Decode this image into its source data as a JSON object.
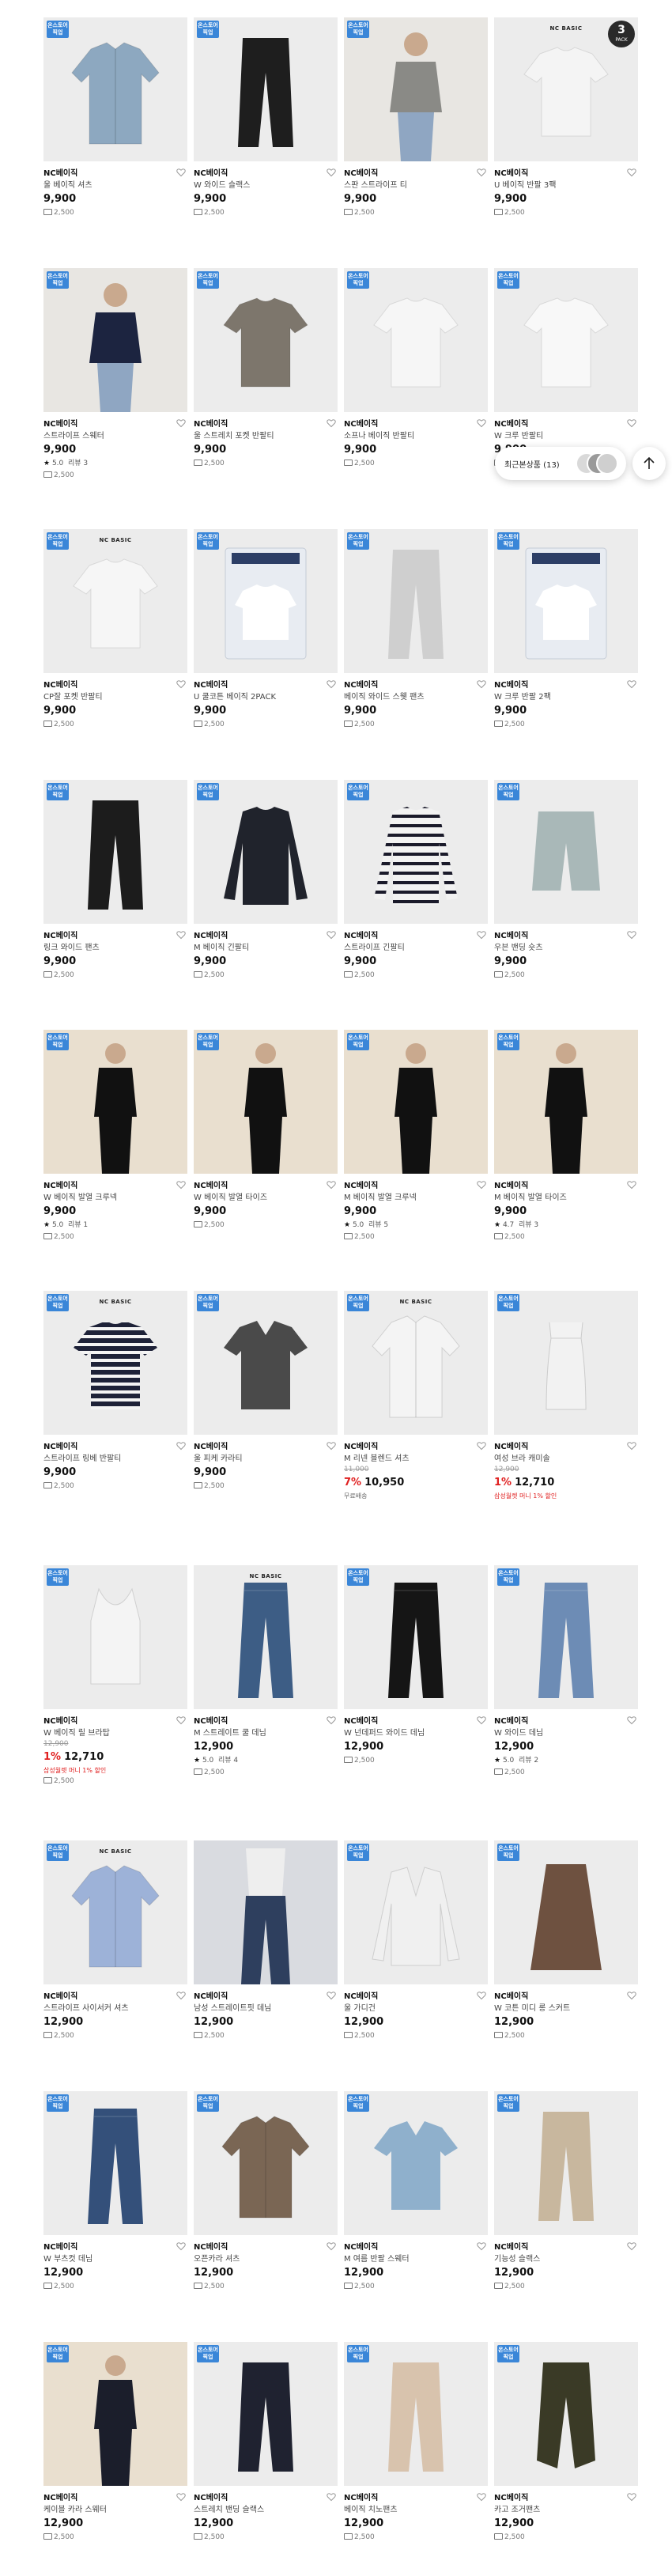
{
  "colors": {
    "badge": "#3a86d8",
    "discount": "#e02020",
    "accent": "#111111"
  },
  "recent": {
    "label": "최근본상품 (13)"
  },
  "products": [
    {
      "badge": "온스토어 픽업",
      "brand": "NC베이직",
      "name": "울 베이직 셔츠",
      "price": "9,900",
      "ship": "2,500",
      "img": "shirt",
      "color": "#8da8c0"
    },
    {
      "badge": "온스토어 픽업",
      "brand": "NC베이직",
      "name": "W 와이드 슬랙스",
      "price": "9,900",
      "ship": "2,500",
      "img": "pants",
      "color": "#1e1e1e"
    },
    {
      "badge": "온스토어 픽업",
      "brand": "NC베이직",
      "name": "스판 스트라이프 티",
      "price": "9,900",
      "ship": "2,500",
      "img": "model-stripe",
      "color": "#8a8a86"
    },
    {
      "brand_mark": "NC BASIC",
      "pack": {
        "n": "3",
        "t": "PACK"
      },
      "brand": "NC베이직",
      "name": "U 베이직 반팔 3팩",
      "price": "9,900",
      "ship": "2,500",
      "img": "tee",
      "color": "#f4f4f4"
    },
    {
      "badge": "온스토어 픽업",
      "brand": "NC베이직",
      "name": "스트라이프 스웨터",
      "price": "9,900",
      "rating": "5.0",
      "reviews": "리뷰 3",
      "ship": "2,500",
      "img": "model-stripe",
      "color": "#1c2440"
    },
    {
      "badge": "온스토어 픽업",
      "brand": "NC베이직",
      "name": "울 스트레치 포켓 반팔티",
      "price": "9,900",
      "ship": "2,500",
      "img": "tee",
      "color": "#7d766c"
    },
    {
      "badge": "온스토어 픽업",
      "brand": "NC베이직",
      "name": "소프나 베이직 반팔티",
      "price": "9,900",
      "ship": "2,500",
      "img": "tee",
      "color": "#f6f6f6"
    },
    {
      "badge": "온스토어 픽업",
      "brand": "NC베이직",
      "name": "W 크루 반팔티",
      "price": "9,900",
      "ship": "2,500",
      "img": "tee",
      "color": "#f8f8f8"
    },
    {
      "badge": "온스토어 픽업",
      "brand_mark": "NC BASIC",
      "brand": "NC베이직",
      "name": "CP잘 포켓 반팔티",
      "price": "9,900",
      "ship": "2,500",
      "img": "tee",
      "color": "#f6f6f6"
    },
    {
      "badge": "온스토어 픽업",
      "brand": "NC베이직",
      "name": "U 쿨코튼 베이직 2PACK",
      "price": "9,900",
      "ship": "2,500",
      "img": "package",
      "color": "#e8ecf2"
    },
    {
      "badge": "온스토어 픽업",
      "brand": "NC베이직",
      "name": "베이직 와이드 스웻 팬츠",
      "price": "9,900",
      "ship": "2,500",
      "img": "pants",
      "color": "#cfcfcf"
    },
    {
      "badge": "온스토어 픽업",
      "brand": "NC베이직",
      "name": "W 크루 반팔 2팩",
      "price": "9,900",
      "ship": "2,500",
      "img": "package",
      "color": "#e8ecf2"
    },
    {
      "badge": "온스토어 픽업",
      "brand": "NC베이직",
      "name": "링크 와이드 팬츠",
      "price": "9,900",
      "ship": "2,500",
      "img": "pants",
      "color": "#1c1c1c"
    },
    {
      "badge": "온스토어 픽업",
      "brand": "NC베이직",
      "name": "M 베이직 긴팔티",
      "price": "9,900",
      "ship": "2,500",
      "img": "longsleeve",
      "color": "#20232c"
    },
    {
      "badge": "온스토어 픽업",
      "brand": "NC베이직",
      "name": "스트라이프 긴팔티",
      "price": "9,900",
      "ship": "2,500",
      "img": "longsleeve-stripe",
      "color": "#f2f2f2"
    },
    {
      "badge": "온스토어 픽업",
      "brand": "NC베이직",
      "name": "우븐 밴딩 숏츠",
      "price": "9,900",
      "ship": "2,500",
      "img": "shorts",
      "color": "#a9b8b8"
    },
    {
      "badge": "온스토어 픽업",
      "brand": "NC베이직",
      "name": "W 베이직 발열 크루넥",
      "price": "9,900",
      "rating": "5.0",
      "reviews": "리뷰 1",
      "ship": "2,500",
      "img": "model-dark",
      "color": "#111111"
    },
    {
      "badge": "온스토어 픽업",
      "brand": "NC베이직",
      "name": "W 베이직 발열 타이즈",
      "price": "9,900",
      "ship": "2,500",
      "img": "model-dark",
      "color": "#111111"
    },
    {
      "badge": "온스토어 픽업",
      "brand": "NC베이직",
      "name": "M 베이직 발열 크루넥",
      "price": "9,900",
      "rating": "5.0",
      "reviews": "리뷰 5",
      "ship": "2,500",
      "img": "model-dark",
      "color": "#111111"
    },
    {
      "badge": "온스토어 픽업",
      "brand": "NC베이직",
      "name": "M 베이직 발열 타이즈",
      "price": "9,900",
      "rating": "4.7",
      "reviews": "리뷰 3",
      "ship": "2,500",
      "img": "model-dark",
      "color": "#111111"
    },
    {
      "badge": "온스토어 픽업",
      "brand_mark": "NC BASIC",
      "brand": "NC베이직",
      "name": "스트라이프 링베 반팔티",
      "price": "9,900",
      "ship": "2,500",
      "img": "tee-stripe",
      "color": "#1e2238"
    },
    {
      "badge": "온스토어 픽업",
      "brand": "NC베이직",
      "name": "울 피케 카라티",
      "price": "9,900",
      "ship": "2,500",
      "img": "polo",
      "color": "#4a4a4a"
    },
    {
      "badge": "온스토어 픽업",
      "brand_mark": "NC BASIC",
      "brand": "NC베이직",
      "name": "M 리넨 블렌드 셔츠",
      "orig": "11,000",
      "disc": "7%",
      "price": "10,950",
      "note_gray": "무료배송",
      "img": "shirt",
      "color": "#f4f4f4"
    },
    {
      "badge": "온스토어 픽업",
      "brand": "NC베이직",
      "name": "여성 브라 캐미솔",
      "orig": "12,900",
      "disc": "1%",
      "price": "12,710",
      "note_red": "삼성월렛 머니 1% 할인",
      "img": "cami",
      "color": "#f2f2f2"
    },
    {
      "badge": "온스토어 픽업",
      "brand": "NC베이직",
      "name": "W 베이직 릴 브라탑",
      "orig": "12,900",
      "disc": "1%",
      "price": "12,710",
      "note_red": "삼성월렛 머니 1% 할인",
      "ship": "2,500",
      "img": "tank",
      "color": "#f4f4f4"
    },
    {
      "brand_mark": "NC BASIC",
      "brand": "NC베이직",
      "name": "M 스트레이트 쿨 데님",
      "price": "12,900",
      "rating": "5.0",
      "reviews": "리뷰 4",
      "ship": "2,500",
      "img": "jeans",
      "color": "#3d5d85"
    },
    {
      "badge": "온스토어 픽업",
      "brand": "NC베이직",
      "name": "W 넌데퍼드 와이드 데님",
      "price": "12,900",
      "ship": "2,500",
      "img": "jeans",
      "color": "#151515"
    },
    {
      "badge": "온스토어 픽업",
      "brand": "NC베이직",
      "name": "W 와이드 데님",
      "price": "12,900",
      "rating": "5.0",
      "reviews": "리뷰 2",
      "ship": "2,500",
      "img": "jeans",
      "color": "#6d8cb5"
    },
    {
      "badge": "온스토어 픽업",
      "brand_mark": "NC BASIC",
      "brand": "NC베이직",
      "name": "스트라이프 사이서커 셔츠",
      "price": "12,900",
      "ship": "2,500",
      "img": "shirt",
      "color": "#9db2d8"
    },
    {
      "brand": "NC베이직",
      "name": "남성 스트레이트핏 데님",
      "price": "12,900",
      "ship": "2,500",
      "img": "model-jeans",
      "color": "#2e3f5e"
    },
    {
      "badge": "온스토어 픽업",
      "brand": "NC베이직",
      "name": "울 가디건",
      "price": "12,900",
      "ship": "2,500",
      "img": "cardigan",
      "color": "#f0f0f0"
    },
    {
      "badge": "온스토어 픽업",
      "brand": "NC베이직",
      "name": "W 코튼 미디 롱 스커트",
      "price": "12,900",
      "ship": "2,500",
      "img": "skirt",
      "color": "#6e5140"
    },
    {
      "badge": "온스토어 픽업",
      "brand": "NC베이직",
      "name": "W 부츠컷 데님",
      "price": "12,900",
      "ship": "2,500",
      "img": "jeans",
      "color": "#34507a"
    },
    {
      "badge": "온스토어 픽업",
      "brand": "NC베이직",
      "name": "오픈카라 셔츠",
      "price": "12,900",
      "ship": "2,500",
      "img": "shirt",
      "color": "#7a6654"
    },
    {
      "badge": "온스토어 픽업",
      "brand": "NC베이직",
      "name": "M 여름 반팔 스웨터",
      "price": "12,900",
      "ship": "2,500",
      "img": "polo",
      "color": "#8fb0cc"
    },
    {
      "badge": "온스토어 픽업",
      "brand": "NC베이직",
      "name": "기능성 슬랙스",
      "price": "12,900",
      "ship": "2,500",
      "img": "pants",
      "color": "#c8b79e"
    },
    {
      "badge": "온스토어 픽업",
      "brand": "NC베이직",
      "name": "케이블 카라 스웨터",
      "price": "12,900",
      "ship": "2,500",
      "img": "model-dark",
      "color": "#1b1e2b"
    },
    {
      "badge": "온스토어 픽업",
      "brand": "NC베이직",
      "name": "스트레치 밴딩 슬랙스",
      "price": "12,900",
      "ship": "2,500",
      "img": "pants",
      "color": "#1f2230"
    },
    {
      "badge": "온스토어 픽업",
      "brand": "NC베이직",
      "name": "베이직 치노팬츠",
      "price": "12,900",
      "ship": "2,500",
      "img": "pants",
      "color": "#d8c3ad"
    },
    {
      "badge": "온스토어 픽업",
      "brand": "NC베이직",
      "name": "카고 조거팬츠",
      "price": "12,900",
      "ship": "2,500",
      "img": "jogger",
      "color": "#3a3a26"
    }
  ]
}
